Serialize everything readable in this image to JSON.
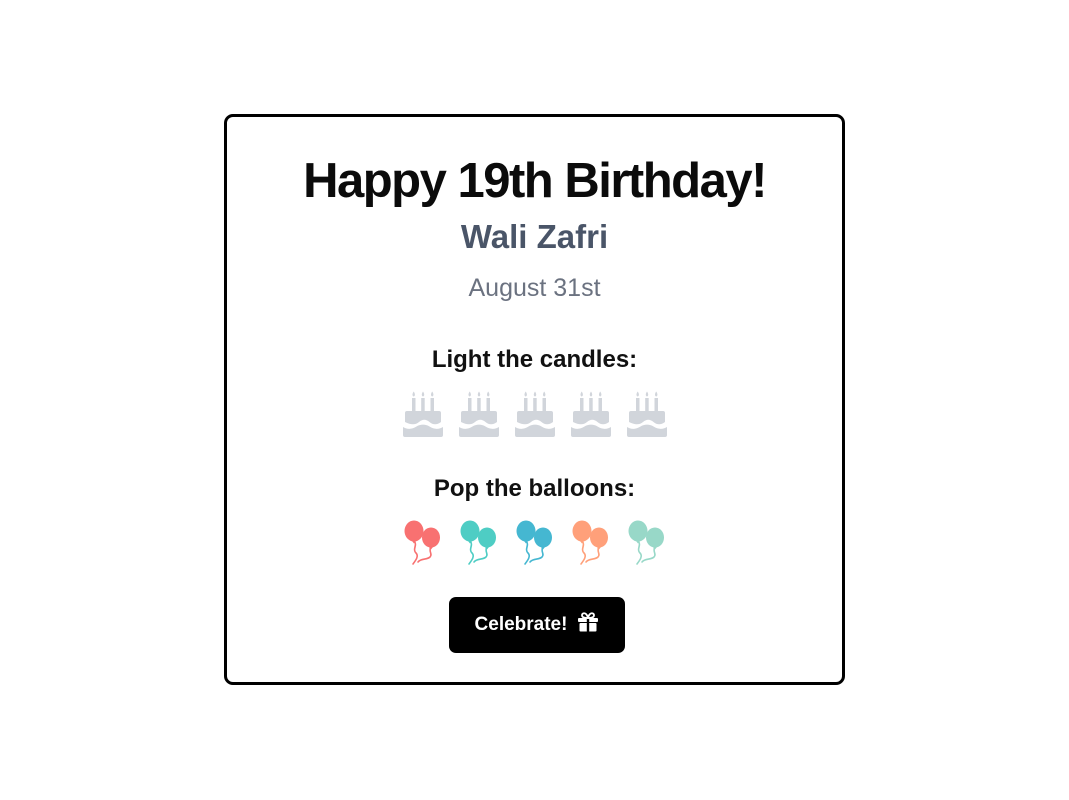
{
  "card": {
    "title": "Happy 19th Birthday!",
    "name": "Wali Zafri",
    "date": "August 31st"
  },
  "candles": {
    "label": "Light the candles:",
    "count": 5,
    "icon": "birthday-cake-icon",
    "color": "#d1d5db"
  },
  "balloons": {
    "label": "Pop the balloons:",
    "icon": "balloons-icon",
    "colors": [
      "#f87171",
      "#4ecdc4",
      "#45b7d1",
      "#ffa07a",
      "#98d8c8"
    ]
  },
  "celebrate_button": {
    "label": "Celebrate!",
    "icon": "gift-icon"
  }
}
